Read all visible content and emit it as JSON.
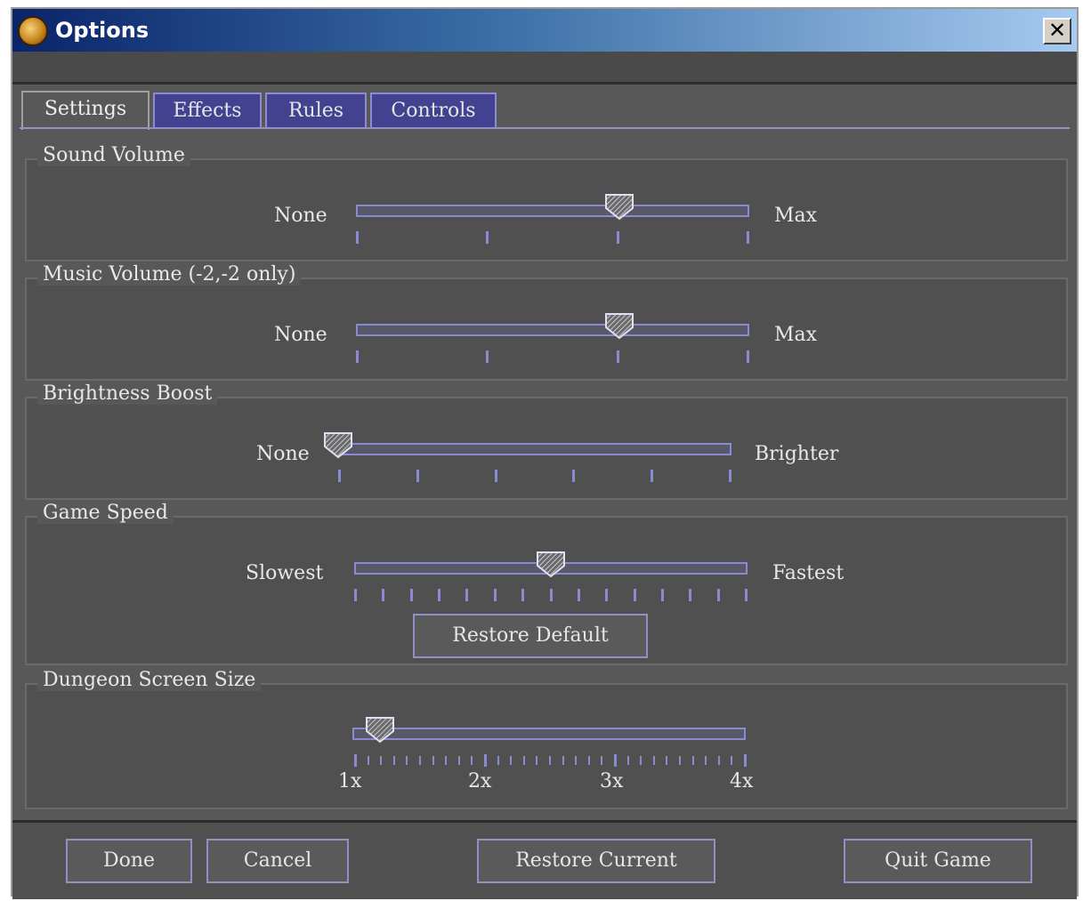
{
  "window": {
    "title": "Options",
    "close_glyph": "✕"
  },
  "tabs": [
    {
      "label": "Settings",
      "active": true
    },
    {
      "label": "Effects",
      "active": false
    },
    {
      "label": "Rules",
      "active": false
    },
    {
      "label": "Controls",
      "active": false
    }
  ],
  "groups": {
    "sound": {
      "title": "Sound Volume",
      "min_label": "None",
      "max_label": "Max",
      "value_fraction": 0.67,
      "ticks": 4
    },
    "music": {
      "title": "Music Volume (-2,-2 only)",
      "min_label": "None",
      "max_label": "Max",
      "value_fraction": 0.67,
      "ticks": 4
    },
    "brightness": {
      "title": "Brightness Boost",
      "min_label": "None",
      "max_label": "Brighter",
      "value_fraction": 0.0,
      "ticks": 6
    },
    "speed": {
      "title": "Game Speed",
      "min_label": "Slowest",
      "max_label": "Fastest",
      "value_fraction": 0.5,
      "ticks": 15,
      "restore_label": "Restore Default"
    },
    "dungeon": {
      "title": "Dungeon Screen Size",
      "value_fraction": 0.07,
      "scale_labels": [
        "1x",
        "2x",
        "3x",
        "4x"
      ]
    }
  },
  "footer": {
    "done": "Done",
    "cancel": "Cancel",
    "restore_current": "Restore Current",
    "quit": "Quit Game"
  },
  "colors": {
    "title_start": "#0a246a",
    "title_end": "#a6caf0",
    "accent": "#8a8ad0",
    "panel": "#585858"
  }
}
